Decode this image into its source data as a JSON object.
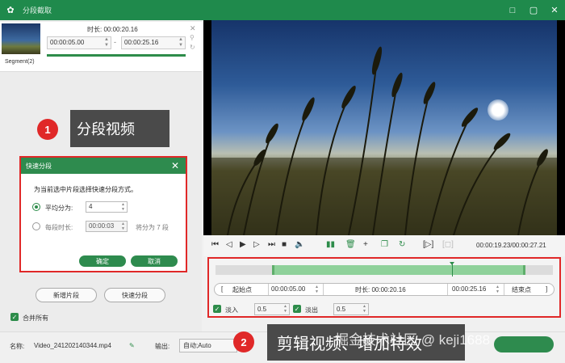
{
  "window": {
    "title": "分段截取",
    "controls": [
      "□",
      "▢",
      "✕"
    ]
  },
  "segment": {
    "label": "Segment(2)",
    "duration": "时长: 00:00:20.16",
    "start": "00:00:05.00",
    "end": "00:00:25.16",
    "separator": "-"
  },
  "callouts": {
    "step1_number": "1",
    "step1_text": "分段视频",
    "step2_number": "2",
    "step2_text": "剪辑视频、增加特效"
  },
  "dialog": {
    "title": "快速分段",
    "description": "为当前选中片段选择快速分段方式。",
    "option_equal_label": "平均分为:",
    "option_equal_value": "4",
    "option_each_label": "每段时长:",
    "option_each_value": "00:00:03",
    "option_each_result": "将分为 7 段",
    "confirm_label": "确定",
    "cancel_label": "取消"
  },
  "left_actions": {
    "new_segment": "新增片段",
    "quick_split": "快速分段",
    "merge_all": "合并所有"
  },
  "bottom": {
    "name_label": "名称:",
    "file_name": "Video_241202140344.mp4",
    "output_label": "输出:",
    "output_value": "自动;Auto"
  },
  "player": {
    "time_readout": "00:00:19.23/00:00:27.21"
  },
  "trim": {
    "start_point": "起始点",
    "start_time": "00:00:05.00",
    "duration": "时长: 00:00:20.16",
    "end_time": "00:00:25.16",
    "end_point": "结束点",
    "fade_in_label": "淡入",
    "fade_in_value": "0.5",
    "fade_out_label": "淡出",
    "fade_out_value": "0.5"
  },
  "watermark": "掘金技术社区 @ keji1688",
  "colors": {
    "brand_green": "#1f8a4c",
    "highlight_red": "#e02828",
    "selection_green": "#8fd19a",
    "callout_gray": "#4a4a4a"
  }
}
